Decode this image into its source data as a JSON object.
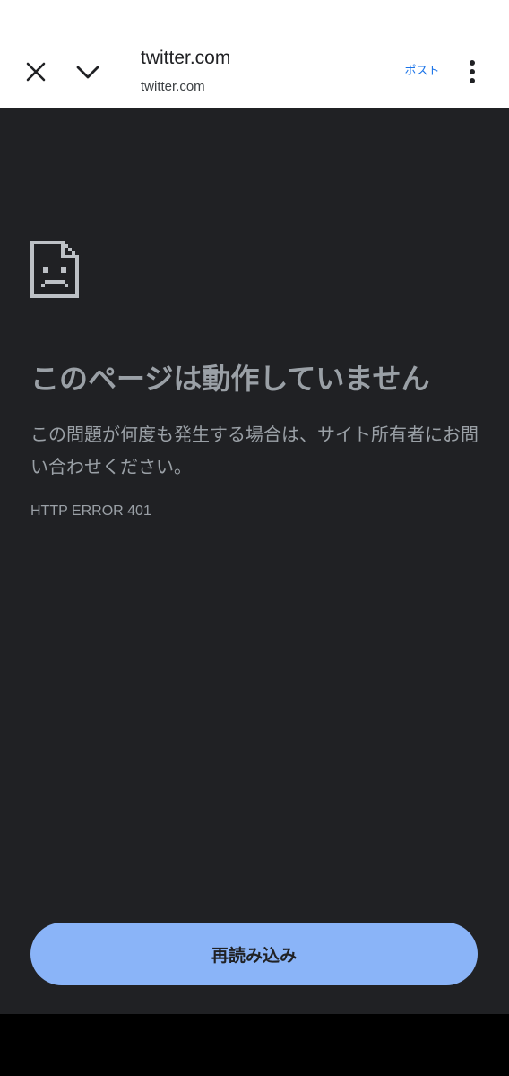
{
  "toolbar": {
    "title": "twitter.com",
    "subtitle": "twitter.com",
    "post_label": "ポスト",
    "close_icon": "close-icon",
    "collapse_icon": "chevron-down-icon",
    "menu_icon": "more-vert-icon"
  },
  "error_page": {
    "icon": "sad-document-icon",
    "heading": "このページは動作していません",
    "message": "この問題が何度も発生する場合は、サイト所有者にお問い合わせください。",
    "error_code": "HTTP ERROR 401",
    "reload_label": "再読み込み"
  },
  "colors": {
    "content_background": "#202124",
    "text_secondary": "#9aa0a6",
    "button_background": "#8ab4f8",
    "link": "#1a73e8"
  }
}
